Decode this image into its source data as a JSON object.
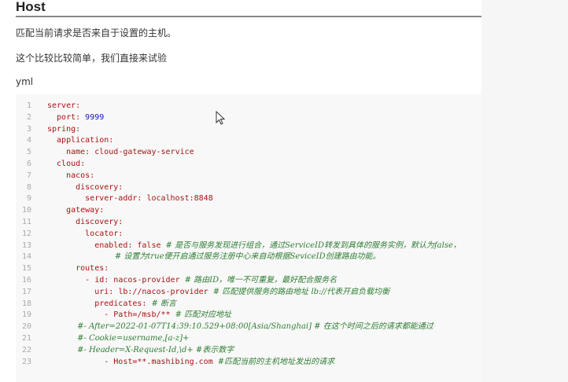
{
  "heading": "Host",
  "paragraphs": [
    "匹配当前请求是否来自于设置的主机。",
    "这个比较比较简单，我们直接来试验",
    "yml"
  ],
  "code": [
    {
      "n": "1",
      "parts": [
        [
          "k",
          "server:"
        ]
      ]
    },
    {
      "n": "2",
      "parts": [
        [
          "k",
          "  port: "
        ],
        [
          "n",
          "9999"
        ]
      ]
    },
    {
      "n": "3",
      "parts": [
        [
          "k",
          "spring:"
        ]
      ]
    },
    {
      "n": "4",
      "parts": [
        [
          "k",
          "  application:"
        ]
      ]
    },
    {
      "n": "5",
      "parts": [
        [
          "k",
          "    name: "
        ],
        [
          "v",
          "cloud-gateway-service"
        ]
      ]
    },
    {
      "n": "6",
      "parts": [
        [
          "k",
          "  cloud:"
        ]
      ]
    },
    {
      "n": "7",
      "parts": [
        [
          "k",
          "    nacos:"
        ]
      ]
    },
    {
      "n": "8",
      "parts": [
        [
          "k",
          "      discovery:"
        ]
      ]
    },
    {
      "n": "9",
      "parts": [
        [
          "k",
          "        server-addr: "
        ],
        [
          "v",
          "localhost:8848"
        ]
      ]
    },
    {
      "n": "10",
      "parts": [
        [
          "k",
          "    gateway:"
        ]
      ]
    },
    {
      "n": "11",
      "parts": [
        [
          "k",
          "      discovery:"
        ]
      ]
    },
    {
      "n": "12",
      "parts": [
        [
          "k",
          "        locator:"
        ]
      ]
    },
    {
      "n": "13",
      "parts": [
        [
          "k",
          "          enabled: "
        ],
        [
          "v",
          "false "
        ],
        [
          "c",
          "# 是否与服务发现进行组合，通过ServiceID转发到具体的服务实例，默认为false，"
        ]
      ]
    },
    {
      "n": "14",
      "parts": [
        [
          "c",
          "                           # 设置为true便开启通过服务注册中心来自动根据SeviceID创建路由功能。"
        ]
      ]
    },
    {
      "n": "15",
      "parts": [
        [
          "k",
          "      routes:"
        ]
      ]
    },
    {
      "n": "16",
      "parts": [
        [
          "k",
          "        - id: "
        ],
        [
          "v",
          "nacos-provider "
        ],
        [
          "c",
          "# 路由ID，唯一不可重复，最好配合服务名"
        ]
      ]
    },
    {
      "n": "17",
      "parts": [
        [
          "k",
          "          uri: "
        ],
        [
          "v",
          "lb://nacos-provider "
        ],
        [
          "c",
          "# 匹配提供服务的路由地址 lb://代表开启负载均衡"
        ]
      ]
    },
    {
      "n": "18",
      "parts": [
        [
          "k",
          "          predicates: "
        ],
        [
          "c",
          "# 断言"
        ]
      ]
    },
    {
      "n": "19",
      "parts": [
        [
          "v",
          "            - Path=/msb/** "
        ],
        [
          "c",
          "# 匹配对应地址"
        ]
      ]
    },
    {
      "n": "20",
      "parts": [
        [
          "c",
          "            #- After=2022-01-07T14:39:10.529+08:00[Asia/Shanghai] # 在这个时间之后的请求都能通过"
        ]
      ]
    },
    {
      "n": "21",
      "parts": [
        [
          "c",
          "            #- Cookie=username,[a-z]+"
        ]
      ]
    },
    {
      "n": "22",
      "parts": [
        [
          "c",
          "            #- Header=X-Request-Id,\\d+ #表示数字"
        ]
      ]
    },
    {
      "n": "23",
      "parts": [
        [
          "v",
          "            - Host=**.mashibing.com "
        ],
        [
          "c",
          "#匹配当前的主机地址发出的请求"
        ]
      ]
    }
  ]
}
